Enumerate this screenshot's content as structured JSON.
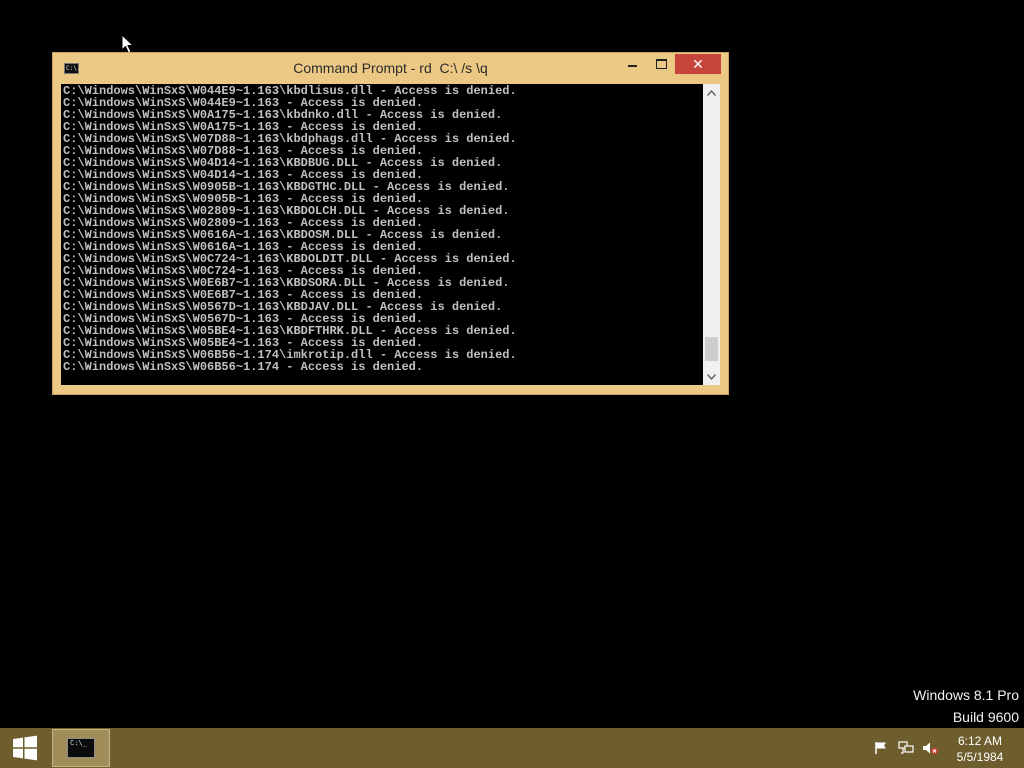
{
  "window": {
    "title": "Command Prompt - rd  C:\\ /s \\q",
    "icon": "cmd-icon",
    "icon_text": "C:\\.",
    "minimize_label": "minimize-icon",
    "maximize_label": "maximize-icon",
    "close_glyph": "✕",
    "accent_color": "#ebc985",
    "close_color": "#c7443b"
  },
  "console": {
    "lines": [
      "C:\\Windows\\WinSxS\\W044E9~1.163\\kbdlisus.dll - Access is denied.",
      "C:\\Windows\\WinSxS\\W044E9~1.163 - Access is denied.",
      "C:\\Windows\\WinSxS\\W0A175~1.163\\kbdnko.dll - Access is denied.",
      "C:\\Windows\\WinSxS\\W0A175~1.163 - Access is denied.",
      "C:\\Windows\\WinSxS\\W07D88~1.163\\kbdphags.dll - Access is denied.",
      "C:\\Windows\\WinSxS\\W07D88~1.163 - Access is denied.",
      "C:\\Windows\\WinSxS\\W04D14~1.163\\KBDBUG.DLL - Access is denied.",
      "C:\\Windows\\WinSxS\\W04D14~1.163 - Access is denied.",
      "C:\\Windows\\WinSxS\\W0905B~1.163\\KBDGTHC.DLL - Access is denied.",
      "C:\\Windows\\WinSxS\\W0905B~1.163 - Access is denied.",
      "C:\\Windows\\WinSxS\\W02809~1.163\\KBDOLCH.DLL - Access is denied.",
      "C:\\Windows\\WinSxS\\W02809~1.163 - Access is denied.",
      "C:\\Windows\\WinSxS\\W0616A~1.163\\KBDOSM.DLL - Access is denied.",
      "C:\\Windows\\WinSxS\\W0616A~1.163 - Access is denied.",
      "C:\\Windows\\WinSxS\\W0C724~1.163\\KBDOLDIT.DLL - Access is denied.",
      "C:\\Windows\\WinSxS\\W0C724~1.163 - Access is denied.",
      "C:\\Windows\\WinSxS\\W0E6B7~1.163\\KBDSORA.DLL - Access is denied.",
      "C:\\Windows\\WinSxS\\W0E6B7~1.163 - Access is denied.",
      "C:\\Windows\\WinSxS\\W0567D~1.163\\KBDJAV.DLL - Access is denied.",
      "C:\\Windows\\WinSxS\\W0567D~1.163 - Access is denied.",
      "C:\\Windows\\WinSxS\\W05BE4~1.163\\KBDFTHRK.DLL - Access is denied.",
      "C:\\Windows\\WinSxS\\W05BE4~1.163 - Access is denied.",
      "C:\\Windows\\WinSxS\\W06B56~1.174\\imkrotip.dll - Access is denied.",
      "C:\\Windows\\WinSxS\\W06B56~1.174 - Access is denied."
    ],
    "text_color": "#c0c0c0",
    "background_color": "#000000",
    "scroll_position": 0.97
  },
  "watermark": {
    "line1": "Windows 8.1 Pro",
    "line2": "Build 9600"
  },
  "taskbar": {
    "color": "#6e5e2e",
    "start_icon": "windows-logo-icon",
    "running_apps": [
      {
        "name": "command-prompt",
        "icon": "cmd-icon",
        "icon_text": "C:\\_",
        "active": true
      }
    ],
    "tray_icons": [
      "action-center-flag-icon",
      "network-icon",
      "volume-muted-icon"
    ],
    "clock": {
      "time": "6:12 AM",
      "date": "5/5/1984"
    }
  }
}
